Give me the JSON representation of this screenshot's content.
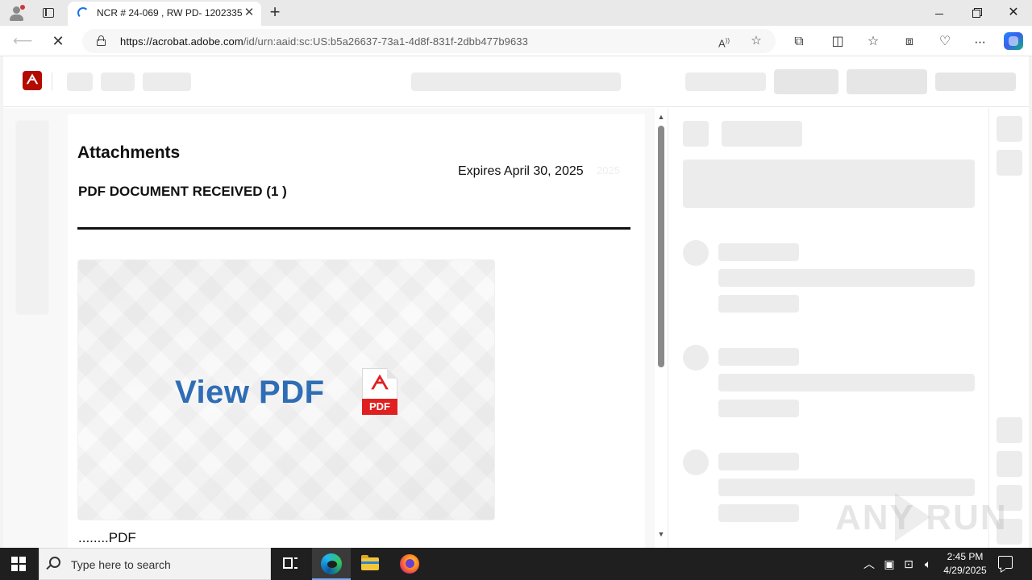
{
  "browser": {
    "tab_title": "NCR # 24-069 , RW PD- 1202335 -",
    "url_host": "https://acrobat.adobe.com",
    "url_path": "/id/urn:aaid:sc:US:b5a26637-73a1-4d8f-831f-2dbb477b9633",
    "icons": {
      "back": "arrow-left-icon",
      "stop": "close-icon",
      "read_aloud": "read-aloud-icon",
      "favorite": "star-icon",
      "extensions": "puzzle-icon",
      "split_screen": "split-screen-icon",
      "favorites": "favorites-icon",
      "collections": "collections-icon",
      "performance": "heart-pulse-icon",
      "more": "ellipsis-icon",
      "copilot": "copilot-icon"
    }
  },
  "document": {
    "heading": "Attachments",
    "expires": "Expires April 30, 2025",
    "received": "PDF DOCUMENT RECEIVED (1 )",
    "view_pdf": "View PDF",
    "pdf_icon_label": "PDF",
    "footer_text": "........PDF"
  },
  "watermark": "ANY RUN",
  "taskbar": {
    "search_placeholder": "Type here to search",
    "time": "2:45 PM",
    "date": "4/29/2025"
  },
  "colors": {
    "adobe_red": "#b30b00",
    "view_pdf_blue": "#2f6db5",
    "pdf_red": "#e02020",
    "taskbar": "#1f1f1f"
  }
}
